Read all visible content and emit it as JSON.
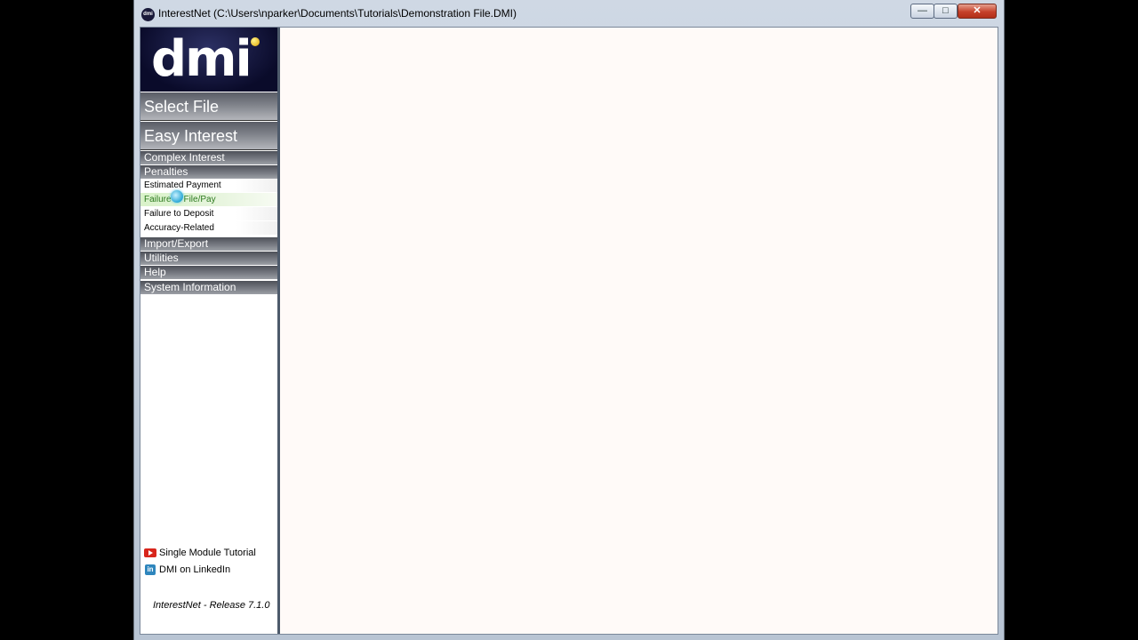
{
  "window": {
    "title": "InterestNet (C:\\Users\\nparker\\Documents\\Tutorials\\Demonstration File.DMI)",
    "app_icon_label": "dmi",
    "minimize_glyph": "—",
    "maximize_glyph": "□",
    "close_glyph": "✕"
  },
  "sidebar": {
    "logo_text": "dmi",
    "primary": [
      {
        "label": "Select File"
      },
      {
        "label": "Easy Interest"
      }
    ],
    "sections": [
      {
        "label": "Complex Interest"
      },
      {
        "label": "Penalties"
      }
    ],
    "penalty_items": [
      {
        "label": "Estimated Payment"
      },
      {
        "label": "Failure to File/Pay"
      },
      {
        "label": "Failure to Deposit"
      },
      {
        "label": "Accuracy-Related"
      }
    ],
    "bottom_sections": [
      {
        "label": "Import/Export"
      },
      {
        "label": "Utilities"
      },
      {
        "label": "Help"
      },
      {
        "label": "System Information"
      }
    ],
    "links": [
      {
        "label": "Single Module Tutorial",
        "icon": "youtube-icon"
      },
      {
        "label": "DMI on LinkedIn",
        "icon": "linkedin-icon",
        "icon_text": "in"
      }
    ],
    "release": "InterestNet - Release 7.1.0"
  },
  "colors": {
    "main_background": "#fffaf8",
    "active_item": "#d9f2c9"
  }
}
